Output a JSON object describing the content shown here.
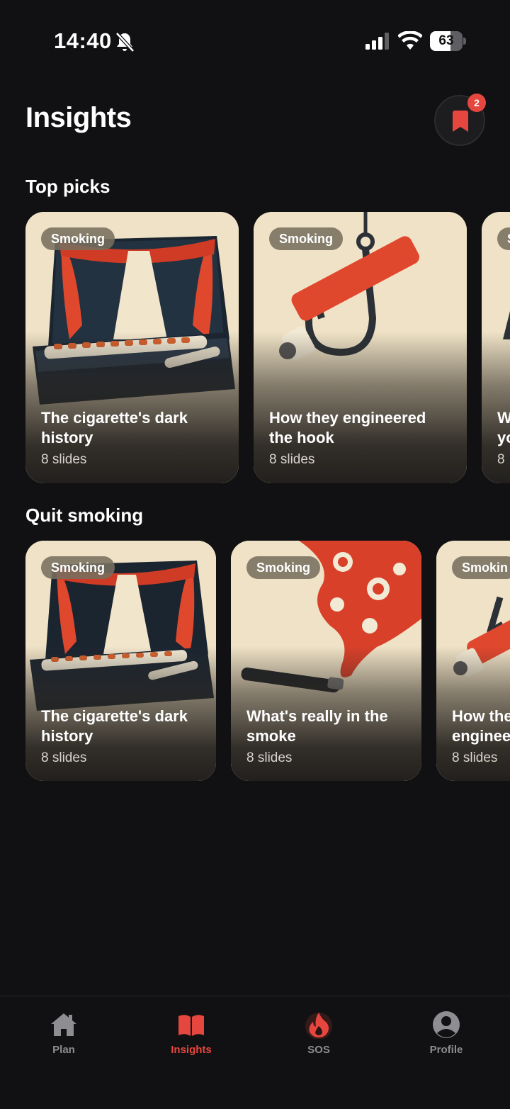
{
  "status_bar": {
    "time": "14:40",
    "battery": "63",
    "battery_level": 0.63
  },
  "header": {
    "title": "Insights",
    "saved_count": "2"
  },
  "sections": [
    {
      "title": "Top picks",
      "cards": [
        {
          "tag": "Smoking",
          "title_line1": "The cigarette's dark",
          "title_line2": "history",
          "meta": "8 slides",
          "art": "cigarette-case-theater"
        },
        {
          "tag": "Smoking",
          "title_line1": "How they engineered",
          "title_line2": "the hook",
          "meta": "8 slides",
          "art": "cigarette-fishhook"
        },
        {
          "tag": "S",
          "title_line1": "W",
          "title_line2": "yo",
          "meta": "8",
          "art": "partial-card"
        }
      ]
    },
    {
      "title": "Quit smoking",
      "cards": [
        {
          "tag": "Smoking",
          "title_line1": "The cigarette's dark",
          "title_line2": "history",
          "meta": "8 slides",
          "art": "cigarette-case-theater"
        },
        {
          "tag": "Smoking",
          "title_line1": "What's really in the",
          "title_line2": "smoke",
          "meta": "8 slides",
          "art": "toxic-smoke"
        },
        {
          "tag": "Smokin",
          "title_line1": "How the",
          "title_line2": "enginee",
          "meta": "8 slides",
          "art": "cigarette-fishhook"
        }
      ]
    }
  ],
  "tabs": [
    {
      "label": "Plan",
      "icon": "home-icon",
      "active": false
    },
    {
      "label": "Insights",
      "icon": "book-icon",
      "active": true
    },
    {
      "label": "SOS",
      "icon": "flame-icon",
      "active": false
    },
    {
      "label": "Profile",
      "icon": "user-icon",
      "active": false
    }
  ],
  "colors": {
    "background": "#111113",
    "accent": "#e5473f",
    "card_cream": "#efe2c6",
    "muted": "#8d8d92"
  }
}
